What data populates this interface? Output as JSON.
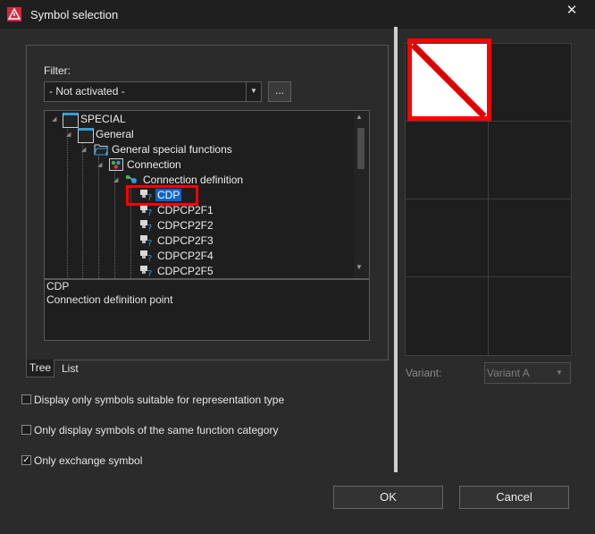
{
  "window": {
    "title": "Symbol selection",
    "close_glyph": "✕",
    "app_icon": "eplan-warning-icon"
  },
  "filter": {
    "label": "Filter:",
    "value": "- Not activated -",
    "more_label": "..."
  },
  "tree": {
    "items": [
      {
        "label": "SPECIAL",
        "icon": "folder-icon"
      },
      {
        "label": "General",
        "icon": "folder-icon"
      },
      {
        "label": "General special functions",
        "icon": "folder-open-icon"
      },
      {
        "label": "Connection",
        "icon": "symbol-library-icon"
      },
      {
        "label": "Connection definition",
        "icon": "connection-icon"
      },
      {
        "label": "CDP",
        "icon": "symbol-icon",
        "selected": true
      },
      {
        "label": "CDPCP2F1",
        "icon": "symbol-icon"
      },
      {
        "label": "CDPCP2F2",
        "icon": "symbol-icon"
      },
      {
        "label": "CDPCP2F3",
        "icon": "symbol-icon"
      },
      {
        "label": "CDPCP2F4",
        "icon": "symbol-icon"
      },
      {
        "label": "CDPCP2F5",
        "icon": "symbol-icon"
      }
    ]
  },
  "description": {
    "name": "CDP",
    "text": "Connection definition point"
  },
  "tabs": [
    {
      "label": "Tree",
      "active": true
    },
    {
      "label": "List",
      "active": false
    }
  ],
  "options": [
    {
      "label": "Display only symbols suitable for representation type",
      "checked": false
    },
    {
      "label": "Only display symbols of the same function category",
      "checked": false
    },
    {
      "label": "Only exchange symbol",
      "checked": true
    }
  ],
  "variant": {
    "label": "Variant:",
    "value": "Variant A"
  },
  "buttons": {
    "ok": "OK",
    "cancel": "Cancel"
  },
  "colors": {
    "highlight": "#ff0000",
    "selection": "#0a64c8",
    "accent": "#2b9fd8"
  }
}
